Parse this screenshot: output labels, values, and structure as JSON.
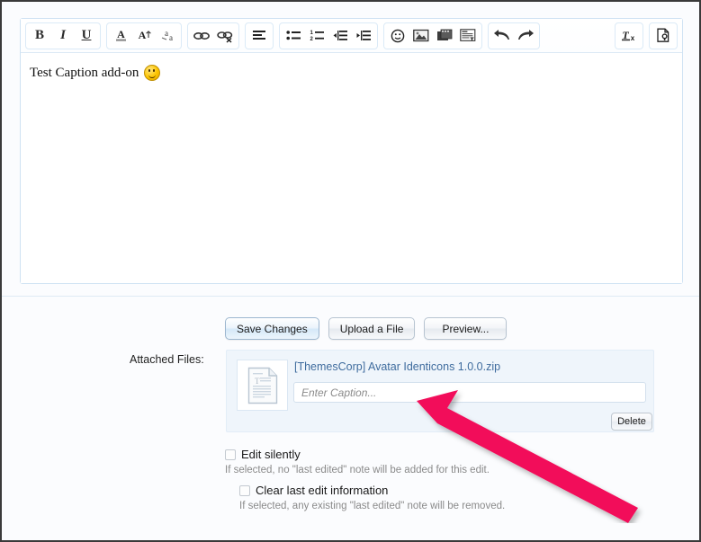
{
  "window": {
    "background": "#fbfcfe",
    "border_color": "#3a3a3a"
  },
  "editor": {
    "content_text": "Test Caption add-on",
    "content_emoji": "smiley-face",
    "toolbar": {
      "groups": [
        {
          "name": "text-style",
          "buttons": [
            {
              "name": "bold-icon",
              "label": "B",
              "title": "Bold"
            },
            {
              "name": "italic-icon",
              "label": "I",
              "title": "Italic"
            },
            {
              "name": "underline-icon",
              "label": "U",
              "title": "Underline"
            }
          ]
        },
        {
          "name": "font-options",
          "buttons": [
            {
              "name": "text-color-icon",
              "label": "A",
              "title": "Text color"
            },
            {
              "name": "font-size-icon",
              "label": "A",
              "title": "Font size"
            },
            {
              "name": "font-family-icon",
              "label": "a",
              "title": "Font family"
            }
          ]
        },
        {
          "name": "link-options",
          "buttons": [
            {
              "name": "insert-link-icon",
              "label": "",
              "title": "Insert link"
            },
            {
              "name": "unlink-icon",
              "label": "",
              "title": "Unlink"
            }
          ]
        },
        {
          "name": "alignment",
          "buttons": [
            {
              "name": "align-icon",
              "label": "",
              "title": "Alignment"
            }
          ]
        },
        {
          "name": "lists",
          "buttons": [
            {
              "name": "bullet-list-icon",
              "label": "",
              "title": "Bulleted list"
            },
            {
              "name": "numbered-list-icon",
              "label": "",
              "title": "Numbered list"
            },
            {
              "name": "outdent-icon",
              "label": "",
              "title": "Decrease indent"
            },
            {
              "name": "indent-icon",
              "label": "",
              "title": "Increase indent"
            }
          ]
        },
        {
          "name": "insert",
          "buttons": [
            {
              "name": "smiley-icon",
              "label": "",
              "title": "Insert smilie"
            },
            {
              "name": "image-icon",
              "label": "",
              "title": "Insert image"
            },
            {
              "name": "media-icon",
              "label": "",
              "title": "Insert media"
            },
            {
              "name": "quote-icon",
              "label": "",
              "title": "Insert quote"
            }
          ]
        },
        {
          "name": "history",
          "buttons": [
            {
              "name": "undo-icon",
              "label": "",
              "title": "Undo"
            },
            {
              "name": "redo-icon",
              "label": "",
              "title": "Redo"
            }
          ]
        },
        {
          "name": "remove-format",
          "buttons": [
            {
              "name": "remove-formatting-icon",
              "label": "Tx",
              "title": "Remove formatting"
            }
          ]
        },
        {
          "name": "toggle-editor",
          "buttons": [
            {
              "name": "source-mode-icon",
              "label": "",
              "title": "Toggle BB code"
            }
          ]
        }
      ]
    }
  },
  "actions": {
    "save_label": "Save Changes",
    "upload_label": "Upload a File",
    "preview_label": "Preview..."
  },
  "attachments": {
    "section_label": "Attached Files:",
    "file_name": "[ThemesCorp] Avatar Identicons 1.0.0.zip",
    "file_link_color": "#3f6c9e",
    "caption_value": "",
    "caption_placeholder": "Enter Caption...",
    "delete_label": "Delete",
    "panel_background": "#eff5fb",
    "thumbnail_icon": "document-file-icon"
  },
  "options": {
    "edit_silently": {
      "label": "Edit silently",
      "checked": false,
      "hint": "If selected, no \"last edited\" note will be added for this edit."
    },
    "clear_last_edit": {
      "label": "Clear last edit information",
      "checked": false,
      "hint": "If selected, any existing \"last edited\" note will be removed."
    }
  },
  "annotation": {
    "type": "arrow",
    "color": "#f20d5a",
    "points_to": "caption-input",
    "direction": "up-left"
  }
}
